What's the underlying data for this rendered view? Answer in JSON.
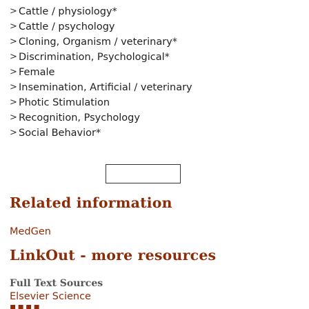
{
  "mesh_terms": [
    {
      "label": "Cattle / physiology*"
    },
    {
      "label": "Cattle / psychology"
    },
    {
      "label": "Cloning, Organism / veterinary*"
    },
    {
      "label": "Discrimination, Psychological*"
    },
    {
      "label": "Female"
    },
    {
      "label": "Insemination, Artificial / veterinary"
    },
    {
      "label": "Photic Stimulation"
    },
    {
      "label": "Recognition, Psychology"
    },
    {
      "label": "Social Behavior*"
    }
  ],
  "related_information": {
    "title": "Related information",
    "links": [
      "MedGen"
    ]
  },
  "linkout": {
    "title": "LinkOut - more resources",
    "full_text_heading": "Full Text Sources",
    "full_text_links": [
      "Elsevier Science"
    ]
  },
  "colors": {
    "accent": "#8c2d0a",
    "text": "#212121",
    "subhead": "#555555"
  },
  "icons": {
    "term_chevron": "chevron-right-icon"
  }
}
